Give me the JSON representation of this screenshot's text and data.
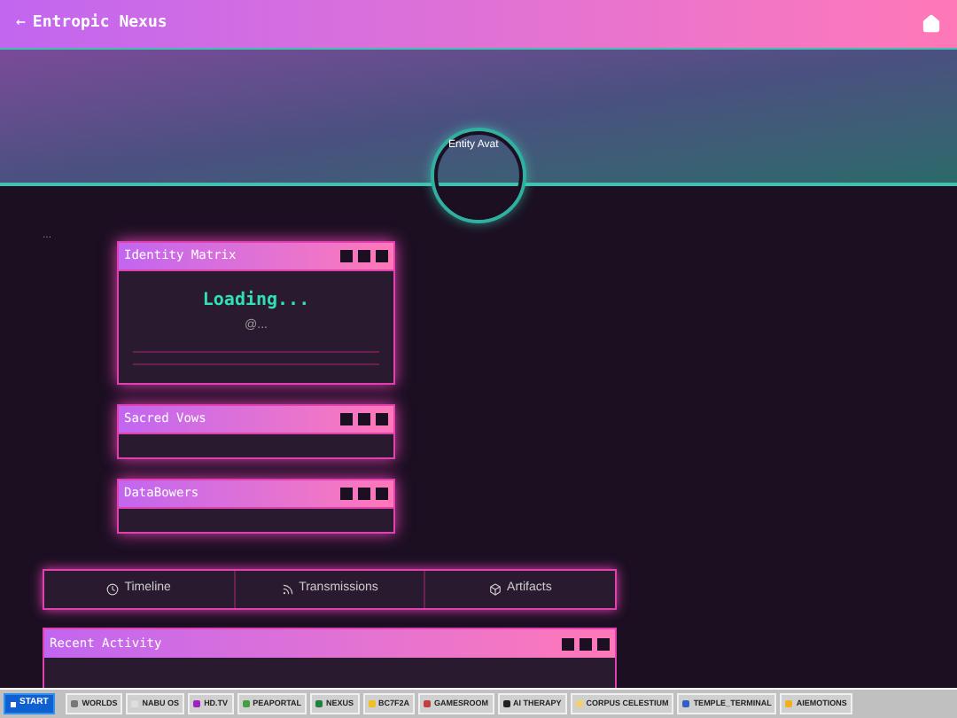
{
  "header": {
    "back": "←",
    "title": "Entropic Nexus"
  },
  "banner": {
    "avatar_alt": "Entity Avat"
  },
  "ellipsis": "...",
  "panels": [
    {
      "title": "Identity Matrix",
      "kind": "loading",
      "status": "Loading...",
      "sub": "@..."
    },
    {
      "title": "Sacred Vows",
      "kind": "empty"
    },
    {
      "title": "DataBowers",
      "kind": "empty"
    }
  ],
  "tabs": [
    {
      "label": "Timeline",
      "selected": false
    },
    {
      "label": "Transmissions",
      "selected": false
    },
    {
      "label": "Artifacts",
      "selected": false
    }
  ],
  "activity": {
    "title": "Recent Activity"
  },
  "taskbar": {
    "start": "START",
    "items": [
      "WORLDS",
      "NABU OS",
      "HD.TV",
      "PEAPORTAL",
      "NEXUS",
      "BC7F2A",
      "GAMESROOM",
      "AI THERAPY",
      "CORPUS CELESTIUM",
      "TEMPLE_TERMINAL",
      "AIEMOTIONS"
    ]
  }
}
